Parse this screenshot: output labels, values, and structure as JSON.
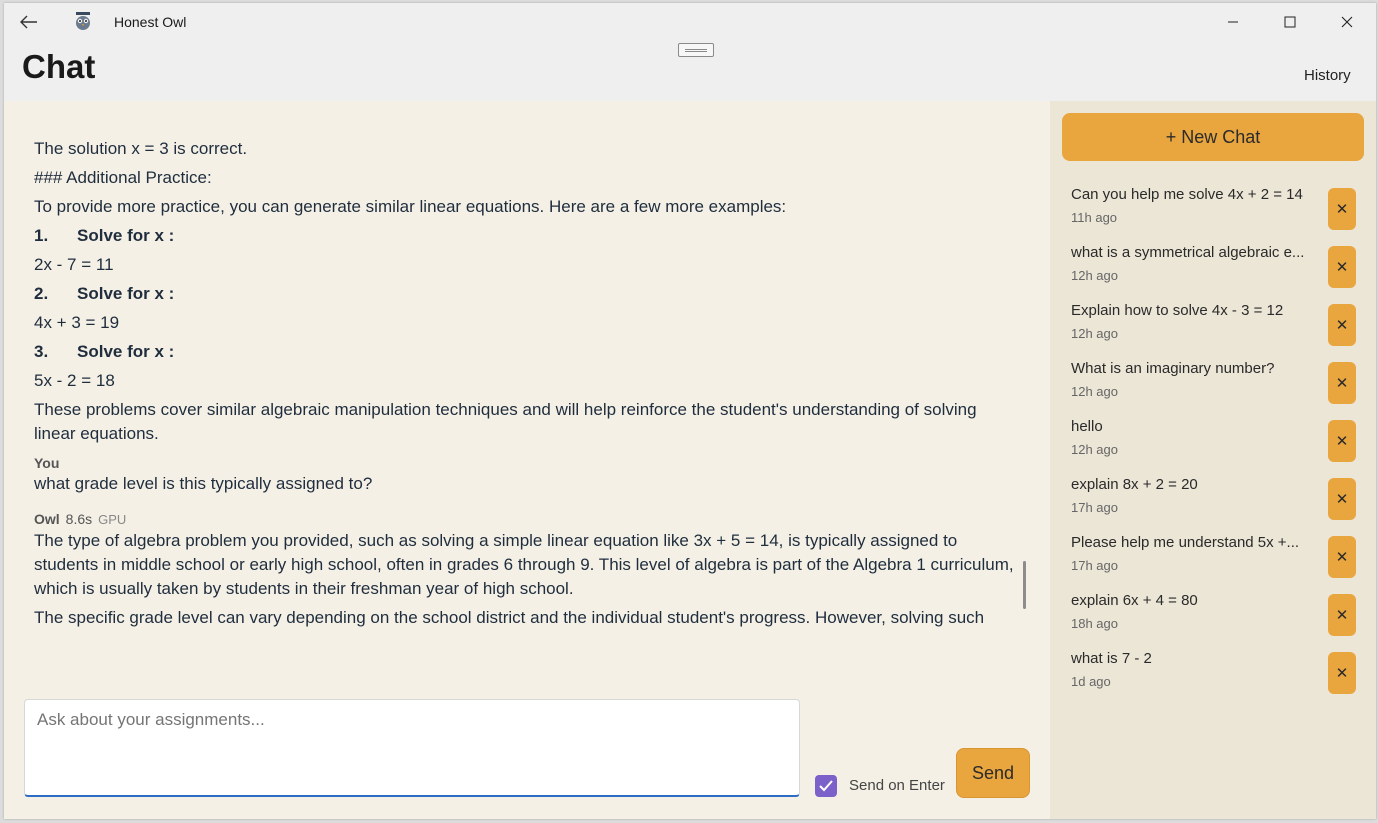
{
  "window": {
    "title": "Honest Owl",
    "back_icon": "arrow-left-icon",
    "minimize_icon": "minimize-icon",
    "maximize_icon": "maximize-icon",
    "close_icon": "close-icon"
  },
  "header": {
    "title": "Chat",
    "history_label": "History"
  },
  "messages": {
    "assistant_prev": {
      "line1": "The solution  x = 3  is correct.",
      "line2": "### Additional Practice:",
      "line3": "To provide more practice, you can generate similar linear equations. Here are a few more examples:",
      "items": [
        {
          "num": "1.",
          "label": "Solve for  x :",
          "equation": "2x - 7 = 11"
        },
        {
          "num": "2.",
          "label": "Solve for  x :",
          "equation": "4x + 3 = 19"
        },
        {
          "num": "3.",
          "label": "Solve for  x :",
          "equation": "5x - 2 = 18"
        }
      ],
      "closing": "These problems cover similar algebraic manipulation techniques and will help reinforce the student's understanding of solving linear equations."
    },
    "user": {
      "sender": "You",
      "text": "what grade level is this typically assigned to?"
    },
    "assistant": {
      "sender": "Owl",
      "time": "8.6s",
      "device": "GPU",
      "text": "The type of algebra problem you provided, such as solving a simple linear equation like 3x + 5 = 14, is typically assigned to students in middle school or early high school, often in grades 6 through 9. This level of algebra is part of the Algebra 1 curriculum, which is usually taken by students in their freshman year of high school.",
      "text_cut": "The specific grade level can vary depending on the school district and the individual student's progress. However, solving such"
    }
  },
  "composer": {
    "placeholder": "Ask about your assignments...",
    "send_on_enter_label": "Send on Enter",
    "send_on_enter_checked": true,
    "send_label": "Send"
  },
  "sidebar": {
    "new_chat_label": "+ New Chat",
    "delete_icon": "close-icon",
    "items": [
      {
        "title": "Can you help me solve 4x + 2 = 14",
        "time": "11h ago"
      },
      {
        "title": "what is a symmetrical algebraic e...",
        "time": "12h ago"
      },
      {
        "title": "Explain how to solve 4x - 3 = 12",
        "time": "12h ago"
      },
      {
        "title": "What is an imaginary number?",
        "time": "12h ago"
      },
      {
        "title": "hello",
        "time": "12h ago"
      },
      {
        "title": "explain 8x + 2 = 20",
        "time": "17h ago"
      },
      {
        "title": "Please help me understand 5x +...",
        "time": "17h ago"
      },
      {
        "title": "explain 6x + 4 = 80",
        "time": "18h ago"
      },
      {
        "title": "what is 7 - 2",
        "time": "1d ago"
      }
    ]
  },
  "colors": {
    "accent": "#e9a53e",
    "chat_bg": "#f4f0e6",
    "sidebar_bg": "#ece6d7",
    "checkbox": "#7b61c9",
    "input_focus": "#2b6cc4"
  }
}
